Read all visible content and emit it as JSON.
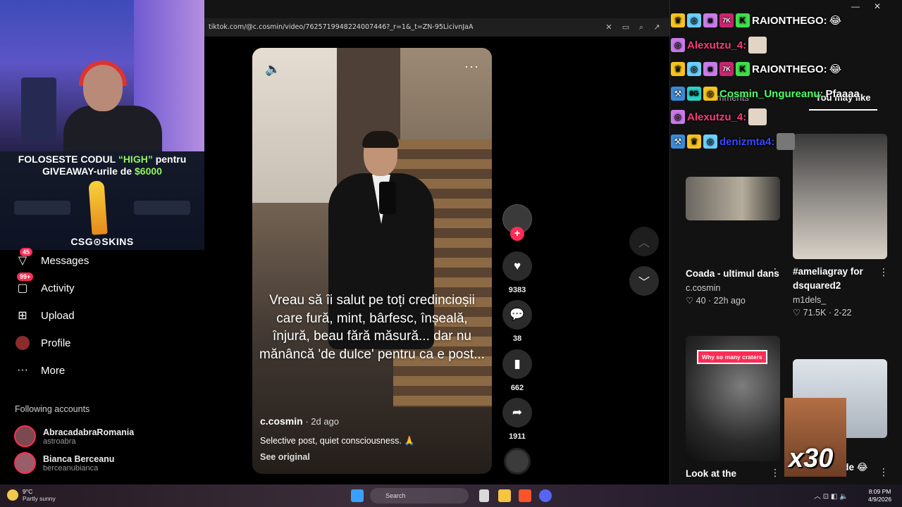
{
  "browser": {
    "url": "tiktok.com/@c.cosmin/video/7625719948224007446?_r=1&_t=ZN-95LicivnJaA"
  },
  "promo": {
    "line1_prefix": "FOLOSESTE CODUL ",
    "line1_code": "“HIGH”",
    "line1_suffix": " pentru",
    "line2_prefix": "GIVEAWAY-urile de ",
    "line2_amount": "$6000",
    "brand": "CSG⊙SKINS"
  },
  "nav": {
    "messages": {
      "label": "Messages",
      "badge": "45"
    },
    "activity": {
      "label": "Activity",
      "badge": "99+"
    },
    "upload": {
      "label": "Upload"
    },
    "profile": {
      "label": "Profile"
    },
    "more": {
      "label": "More"
    }
  },
  "following": {
    "title": "Following accounts",
    "accounts": [
      {
        "name": "AbracadabraRomania",
        "handle": "astroabra"
      },
      {
        "name": "Bianca Berceanu",
        "handle": "berceanubianca"
      }
    ]
  },
  "video": {
    "caption": "Vreau să îi salut pe toți credincioșii care fură, mint, bârfesc, înșeală, înjură, beau fără măsură... dar nu mănâncă 'de dulce' pentru ca e post...",
    "author": "c.cosmin",
    "ago": " · 2d ago",
    "description": "Selective post, quiet consciousness. 🙏",
    "see_original": "See original"
  },
  "actions": {
    "likes": "9383",
    "comments": "38",
    "saves": "662",
    "shares": "1911"
  },
  "panel": {
    "tab_comments": "Comments",
    "tab_you_may_like": "You may like",
    "cards": [
      {
        "title": "Coada - ultimul dans",
        "user": "c.cosmin",
        "meta": "♡ 40 · 22h ago"
      },
      {
        "title": "#ameliagray for dsquared2",
        "user": "m1dels_",
        "meta": "♡ 71.5K · 2-22"
      },
      {
        "title": "Look at the",
        "overlay": "Why so many craters"
      },
      {
        "title": "bro doar râde 😂"
      }
    ]
  },
  "chat": [
    {
      "user": "RAIONTHEGO:",
      "msg": "😂",
      "color": "#ffffff"
    },
    {
      "user": "Alexutzu_4:",
      "msg": "",
      "color": "#ff3b7a"
    },
    {
      "user": "RAIONTHEGO:",
      "msg": "😂",
      "color": "#ffffff"
    },
    {
      "user": "Cosmin_Ungureanu:",
      "msg": "Pfaaaa",
      "color": "#4fff6a"
    },
    {
      "user": "Alexutzu_4:",
      "msg": "",
      "color": "#ff3b7a"
    },
    {
      "user": "denizmta4:",
      "msg": "",
      "color": "#3a46ff"
    }
  ],
  "emote_multiplier": "x30",
  "taskbar": {
    "temp": "9°C",
    "weather": "Partly sunny",
    "search": "Search",
    "time": "8:09 PM",
    "date": "4/9/2026"
  },
  "colors": {
    "accent": "#fe2c55",
    "promo_green": "#8ef55b"
  }
}
